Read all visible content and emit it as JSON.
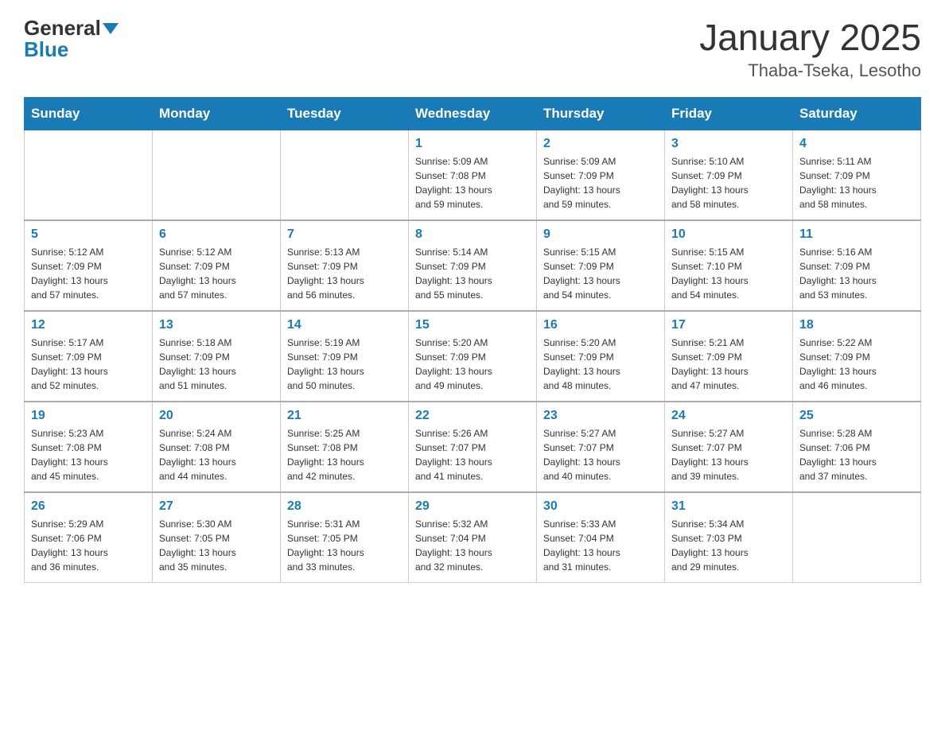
{
  "header": {
    "logo_line1": "General",
    "logo_line2": "Blue",
    "month_title": "January 2025",
    "subtitle": "Thaba-Tseka, Lesotho"
  },
  "days_of_week": [
    "Sunday",
    "Monday",
    "Tuesday",
    "Wednesday",
    "Thursday",
    "Friday",
    "Saturday"
  ],
  "weeks": [
    [
      {
        "day": "",
        "info": ""
      },
      {
        "day": "",
        "info": ""
      },
      {
        "day": "",
        "info": ""
      },
      {
        "day": "1",
        "info": "Sunrise: 5:09 AM\nSunset: 7:08 PM\nDaylight: 13 hours\nand 59 minutes."
      },
      {
        "day": "2",
        "info": "Sunrise: 5:09 AM\nSunset: 7:09 PM\nDaylight: 13 hours\nand 59 minutes."
      },
      {
        "day": "3",
        "info": "Sunrise: 5:10 AM\nSunset: 7:09 PM\nDaylight: 13 hours\nand 58 minutes."
      },
      {
        "day": "4",
        "info": "Sunrise: 5:11 AM\nSunset: 7:09 PM\nDaylight: 13 hours\nand 58 minutes."
      }
    ],
    [
      {
        "day": "5",
        "info": "Sunrise: 5:12 AM\nSunset: 7:09 PM\nDaylight: 13 hours\nand 57 minutes."
      },
      {
        "day": "6",
        "info": "Sunrise: 5:12 AM\nSunset: 7:09 PM\nDaylight: 13 hours\nand 57 minutes."
      },
      {
        "day": "7",
        "info": "Sunrise: 5:13 AM\nSunset: 7:09 PM\nDaylight: 13 hours\nand 56 minutes."
      },
      {
        "day": "8",
        "info": "Sunrise: 5:14 AM\nSunset: 7:09 PM\nDaylight: 13 hours\nand 55 minutes."
      },
      {
        "day": "9",
        "info": "Sunrise: 5:15 AM\nSunset: 7:09 PM\nDaylight: 13 hours\nand 54 minutes."
      },
      {
        "day": "10",
        "info": "Sunrise: 5:15 AM\nSunset: 7:10 PM\nDaylight: 13 hours\nand 54 minutes."
      },
      {
        "day": "11",
        "info": "Sunrise: 5:16 AM\nSunset: 7:09 PM\nDaylight: 13 hours\nand 53 minutes."
      }
    ],
    [
      {
        "day": "12",
        "info": "Sunrise: 5:17 AM\nSunset: 7:09 PM\nDaylight: 13 hours\nand 52 minutes."
      },
      {
        "day": "13",
        "info": "Sunrise: 5:18 AM\nSunset: 7:09 PM\nDaylight: 13 hours\nand 51 minutes."
      },
      {
        "day": "14",
        "info": "Sunrise: 5:19 AM\nSunset: 7:09 PM\nDaylight: 13 hours\nand 50 minutes."
      },
      {
        "day": "15",
        "info": "Sunrise: 5:20 AM\nSunset: 7:09 PM\nDaylight: 13 hours\nand 49 minutes."
      },
      {
        "day": "16",
        "info": "Sunrise: 5:20 AM\nSunset: 7:09 PM\nDaylight: 13 hours\nand 48 minutes."
      },
      {
        "day": "17",
        "info": "Sunrise: 5:21 AM\nSunset: 7:09 PM\nDaylight: 13 hours\nand 47 minutes."
      },
      {
        "day": "18",
        "info": "Sunrise: 5:22 AM\nSunset: 7:09 PM\nDaylight: 13 hours\nand 46 minutes."
      }
    ],
    [
      {
        "day": "19",
        "info": "Sunrise: 5:23 AM\nSunset: 7:08 PM\nDaylight: 13 hours\nand 45 minutes."
      },
      {
        "day": "20",
        "info": "Sunrise: 5:24 AM\nSunset: 7:08 PM\nDaylight: 13 hours\nand 44 minutes."
      },
      {
        "day": "21",
        "info": "Sunrise: 5:25 AM\nSunset: 7:08 PM\nDaylight: 13 hours\nand 42 minutes."
      },
      {
        "day": "22",
        "info": "Sunrise: 5:26 AM\nSunset: 7:07 PM\nDaylight: 13 hours\nand 41 minutes."
      },
      {
        "day": "23",
        "info": "Sunrise: 5:27 AM\nSunset: 7:07 PM\nDaylight: 13 hours\nand 40 minutes."
      },
      {
        "day": "24",
        "info": "Sunrise: 5:27 AM\nSunset: 7:07 PM\nDaylight: 13 hours\nand 39 minutes."
      },
      {
        "day": "25",
        "info": "Sunrise: 5:28 AM\nSunset: 7:06 PM\nDaylight: 13 hours\nand 37 minutes."
      }
    ],
    [
      {
        "day": "26",
        "info": "Sunrise: 5:29 AM\nSunset: 7:06 PM\nDaylight: 13 hours\nand 36 minutes."
      },
      {
        "day": "27",
        "info": "Sunrise: 5:30 AM\nSunset: 7:05 PM\nDaylight: 13 hours\nand 35 minutes."
      },
      {
        "day": "28",
        "info": "Sunrise: 5:31 AM\nSunset: 7:05 PM\nDaylight: 13 hours\nand 33 minutes."
      },
      {
        "day": "29",
        "info": "Sunrise: 5:32 AM\nSunset: 7:04 PM\nDaylight: 13 hours\nand 32 minutes."
      },
      {
        "day": "30",
        "info": "Sunrise: 5:33 AM\nSunset: 7:04 PM\nDaylight: 13 hours\nand 31 minutes."
      },
      {
        "day": "31",
        "info": "Sunrise: 5:34 AM\nSunset: 7:03 PM\nDaylight: 13 hours\nand 29 minutes."
      },
      {
        "day": "",
        "info": ""
      }
    ]
  ]
}
